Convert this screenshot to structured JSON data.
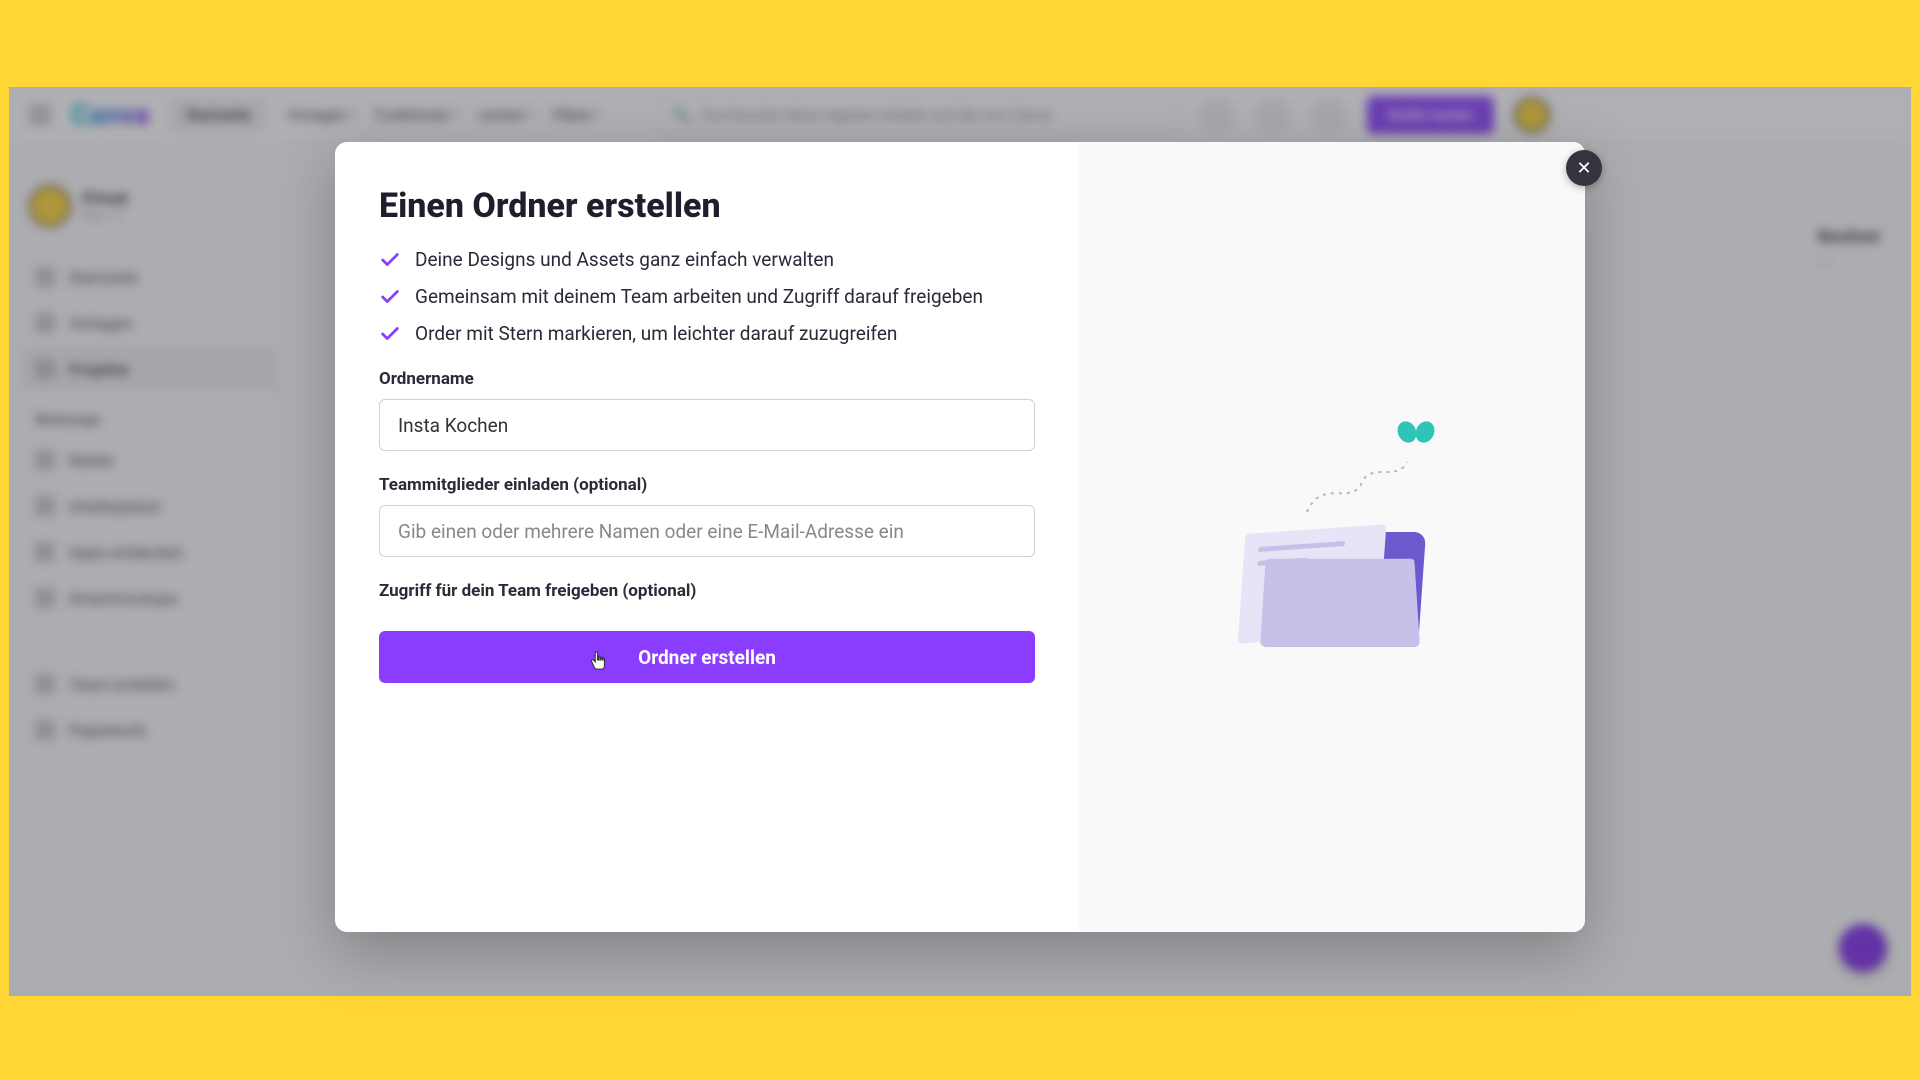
{
  "background_app": {
    "logo": "Canva",
    "nav": {
      "active": "Startseite",
      "items": [
        "Vorlagen",
        "Funktionen",
        "Lernen",
        "Pläne"
      ]
    },
    "search_placeholder": "Durchsuche deine eigenen Inhalte und die von Canva",
    "cta": "Gratis testen",
    "sidebar": {
      "user_name": "Privat",
      "user_sub": "Pro • 1",
      "items_top": [
        "Startseite",
        "Vorlagen",
        "Projekte"
      ],
      "section_heading": "Werkzeuge",
      "items_tools": [
        "Marke",
        "Inhaltsplaner",
        "Apps entdecken",
        "Smartmockups"
      ],
      "items_bottom": [
        "Team erstellen",
        "Papierkorb"
      ]
    },
    "content_col": {
      "heading": "Besitzer",
      "sub": "---"
    }
  },
  "modal": {
    "title": "Einen Ordner erstellen",
    "benefits": [
      "Deine Designs und Assets ganz einfach verwalten",
      "Gemeinsam mit deinem Team arbeiten und Zugriff darauf freigeben",
      "Order mit Stern markieren, um leichter darauf zuzugreifen"
    ],
    "folder_name_label": "Ordnername",
    "folder_name_value": "Insta Kochen",
    "invite_label": "Teammitglieder einladen (optional)",
    "invite_placeholder": "Gib einen oder mehrere Namen oder eine E-Mail-Adresse ein",
    "access_label": "Zugriff für dein Team freigeben (optional)",
    "submit_button": "Ordner erstellen",
    "close_symbol": "✕"
  }
}
